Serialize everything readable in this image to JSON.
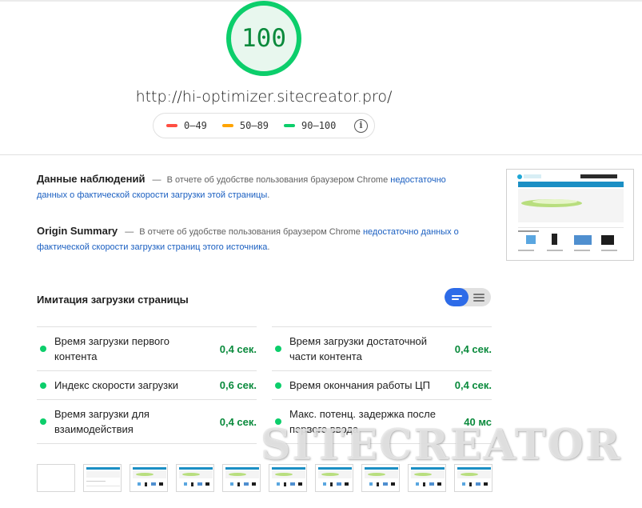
{
  "report": {
    "score": "100",
    "url": "http://hi-optimizer.sitecreator.pro/"
  },
  "legend": {
    "items": [
      {
        "label": "0–49",
        "color": "#ff4e42"
      },
      {
        "label": "50–89",
        "color": "#ffa400"
      },
      {
        "label": "90–100",
        "color": "#0cce6b"
      }
    ],
    "info_icon": "info-icon"
  },
  "field_data": {
    "title": "Данные наблюдений",
    "separator": "—",
    "text": "В отчете об удобстве пользования браузером Chrome",
    "link_part1": "недостаточно",
    "link_part2": "данных о фактической скорости загрузки этой страницы",
    "end": "."
  },
  "origin_summary": {
    "title": "Origin Summary",
    "separator": "—",
    "text": "В отчете об удобстве пользования браузером Chrome",
    "link_part1": "недостаточно данных о",
    "link_part2": "фактической скорости загрузки страниц этого источника",
    "end": "."
  },
  "lab_data": {
    "title": "Имитация загрузки страницы",
    "left_metrics": [
      {
        "label": "Время загрузки первого контента",
        "value": "0,4 сек."
      },
      {
        "label": "Индекс скорости загрузки",
        "value": "0,6 сек."
      },
      {
        "label": "Время загрузки для взаимодействия",
        "value": "0,4 сек."
      }
    ],
    "right_metrics": [
      {
        "label": "Время загрузки достаточной части контента",
        "value": "0,4 сек."
      },
      {
        "label": "Время окончания работы ЦП",
        "value": "0,4 сек."
      },
      {
        "label": "Макс. потенц. задержка после первого ввода",
        "value": "40 мс"
      }
    ]
  },
  "colors": {
    "pass": "#0cce6b",
    "pass_text": "#0a8a3c",
    "link": "#1a5fc1",
    "toggle_active": "#2d6be8"
  },
  "watermark": "SITECREATOR"
}
